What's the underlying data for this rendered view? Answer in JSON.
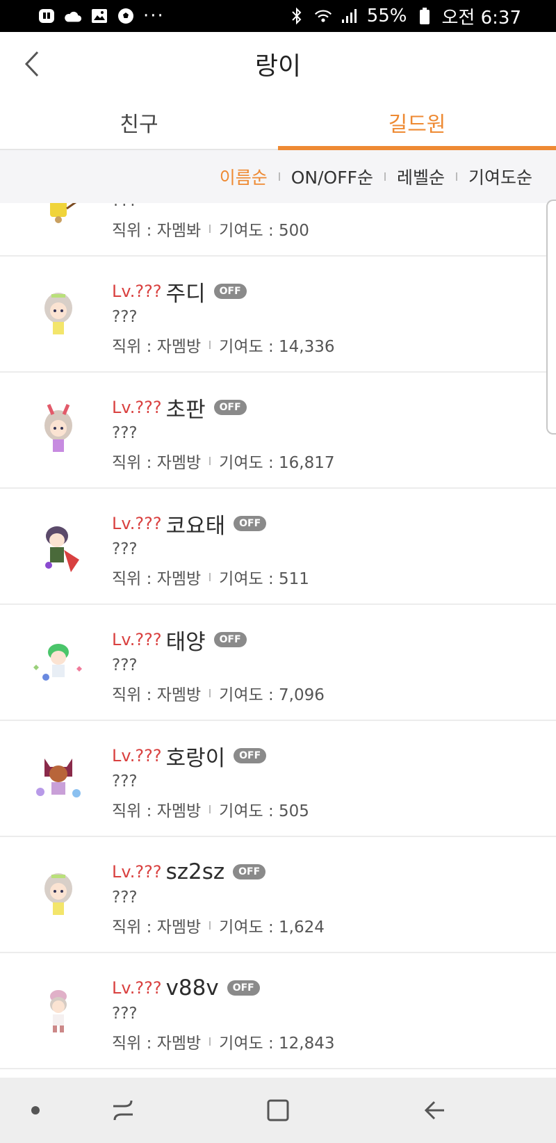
{
  "status_bar": {
    "battery_percent": "55%",
    "time": "오전 6:37",
    "dots": "···"
  },
  "header": {
    "title": "랑이"
  },
  "tabs": [
    {
      "label": "친구"
    },
    {
      "label": "길드원"
    }
  ],
  "sort_options": [
    "이름순",
    "ON/OFF순",
    "레벨순",
    "기여도순"
  ],
  "members": [
    {
      "level": "",
      "name": "",
      "off": "",
      "status": "???",
      "position_label": "직위 : 자멤봐",
      "contribution_label": "기여도 : 500"
    },
    {
      "level": "Lv.???",
      "name": "주디",
      "off": "OFF",
      "status": "???",
      "position_label": "직위 : 자멤방",
      "contribution_label": "기여도 : 14,336"
    },
    {
      "level": "Lv.???",
      "name": "초판",
      "off": "OFF",
      "status": "???",
      "position_label": "직위 : 자멤방",
      "contribution_label": "기여도 : 16,817"
    },
    {
      "level": "Lv.???",
      "name": "코요태",
      "off": "OFF",
      "status": "???",
      "position_label": "직위 : 자멤방",
      "contribution_label": "기여도 : 511"
    },
    {
      "level": "Lv.???",
      "name": "태양",
      "off": "OFF",
      "status": "???",
      "position_label": "직위 : 자멤방",
      "contribution_label": "기여도 : 7,096"
    },
    {
      "level": "Lv.???",
      "name": "호랑이",
      "off": "OFF",
      "status": "???",
      "position_label": "직위 : 자멤방",
      "contribution_label": "기여도 : 505"
    },
    {
      "level": "Lv.???",
      "name": "sz2sz",
      "off": "OFF",
      "status": "???",
      "position_label": "직위 : 자멤방",
      "contribution_label": "기여도 : 1,624"
    },
    {
      "level": "Lv.???",
      "name": "v88v",
      "off": "OFF",
      "status": "???",
      "position_label": "직위 : 자멤방",
      "contribution_label": "기여도 : 12,843"
    }
  ],
  "colors": {
    "accent": "#ee8a33",
    "level_red": "#d9403f",
    "off_badge": "#8a8a8a"
  }
}
